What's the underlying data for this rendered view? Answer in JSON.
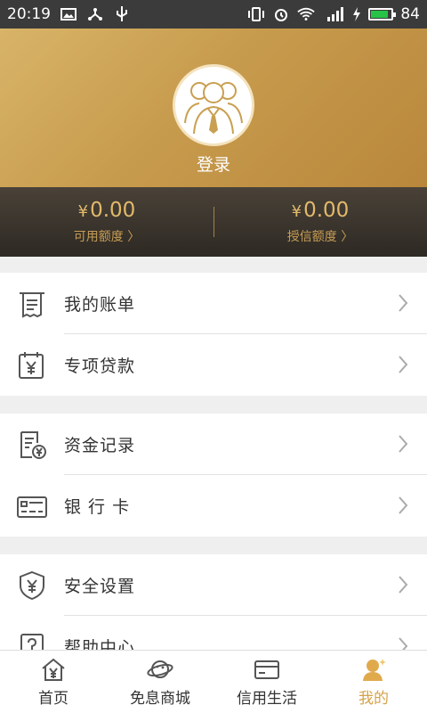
{
  "status_bar": {
    "time": "20:19",
    "battery": "84",
    "network": "4G"
  },
  "profile": {
    "login_label": "登录"
  },
  "credit": {
    "available": {
      "currency": "¥",
      "amount": "0.00",
      "label": "可用额度 〉"
    },
    "granted": {
      "currency": "¥",
      "amount": "0.00",
      "label": "授信额度 〉"
    }
  },
  "menu": {
    "group1": [
      {
        "label": "我的账单",
        "icon": "bill-icon"
      },
      {
        "label": "专项贷款",
        "icon": "loan-calendar-icon"
      }
    ],
    "group2": [
      {
        "label": "资金记录",
        "icon": "fund-record-icon"
      },
      {
        "label": "银 行 卡",
        "icon": "bank-card-icon"
      }
    ],
    "group3": [
      {
        "label": "安全设置",
        "icon": "security-shield-icon"
      },
      {
        "label": "帮助中心",
        "icon": "help-icon"
      }
    ]
  },
  "tabbar": [
    {
      "label": "首页",
      "icon": "home-icon",
      "active": false
    },
    {
      "label": "免息商城",
      "icon": "planet-icon",
      "active": false
    },
    {
      "label": "信用生活",
      "icon": "card-icon",
      "active": false
    },
    {
      "label": "我的",
      "icon": "profile-icon",
      "active": true
    }
  ],
  "colors": {
    "accent": "#d4a34b",
    "header_gold": "#c79b4d",
    "strip_dark": "#2d2923"
  }
}
